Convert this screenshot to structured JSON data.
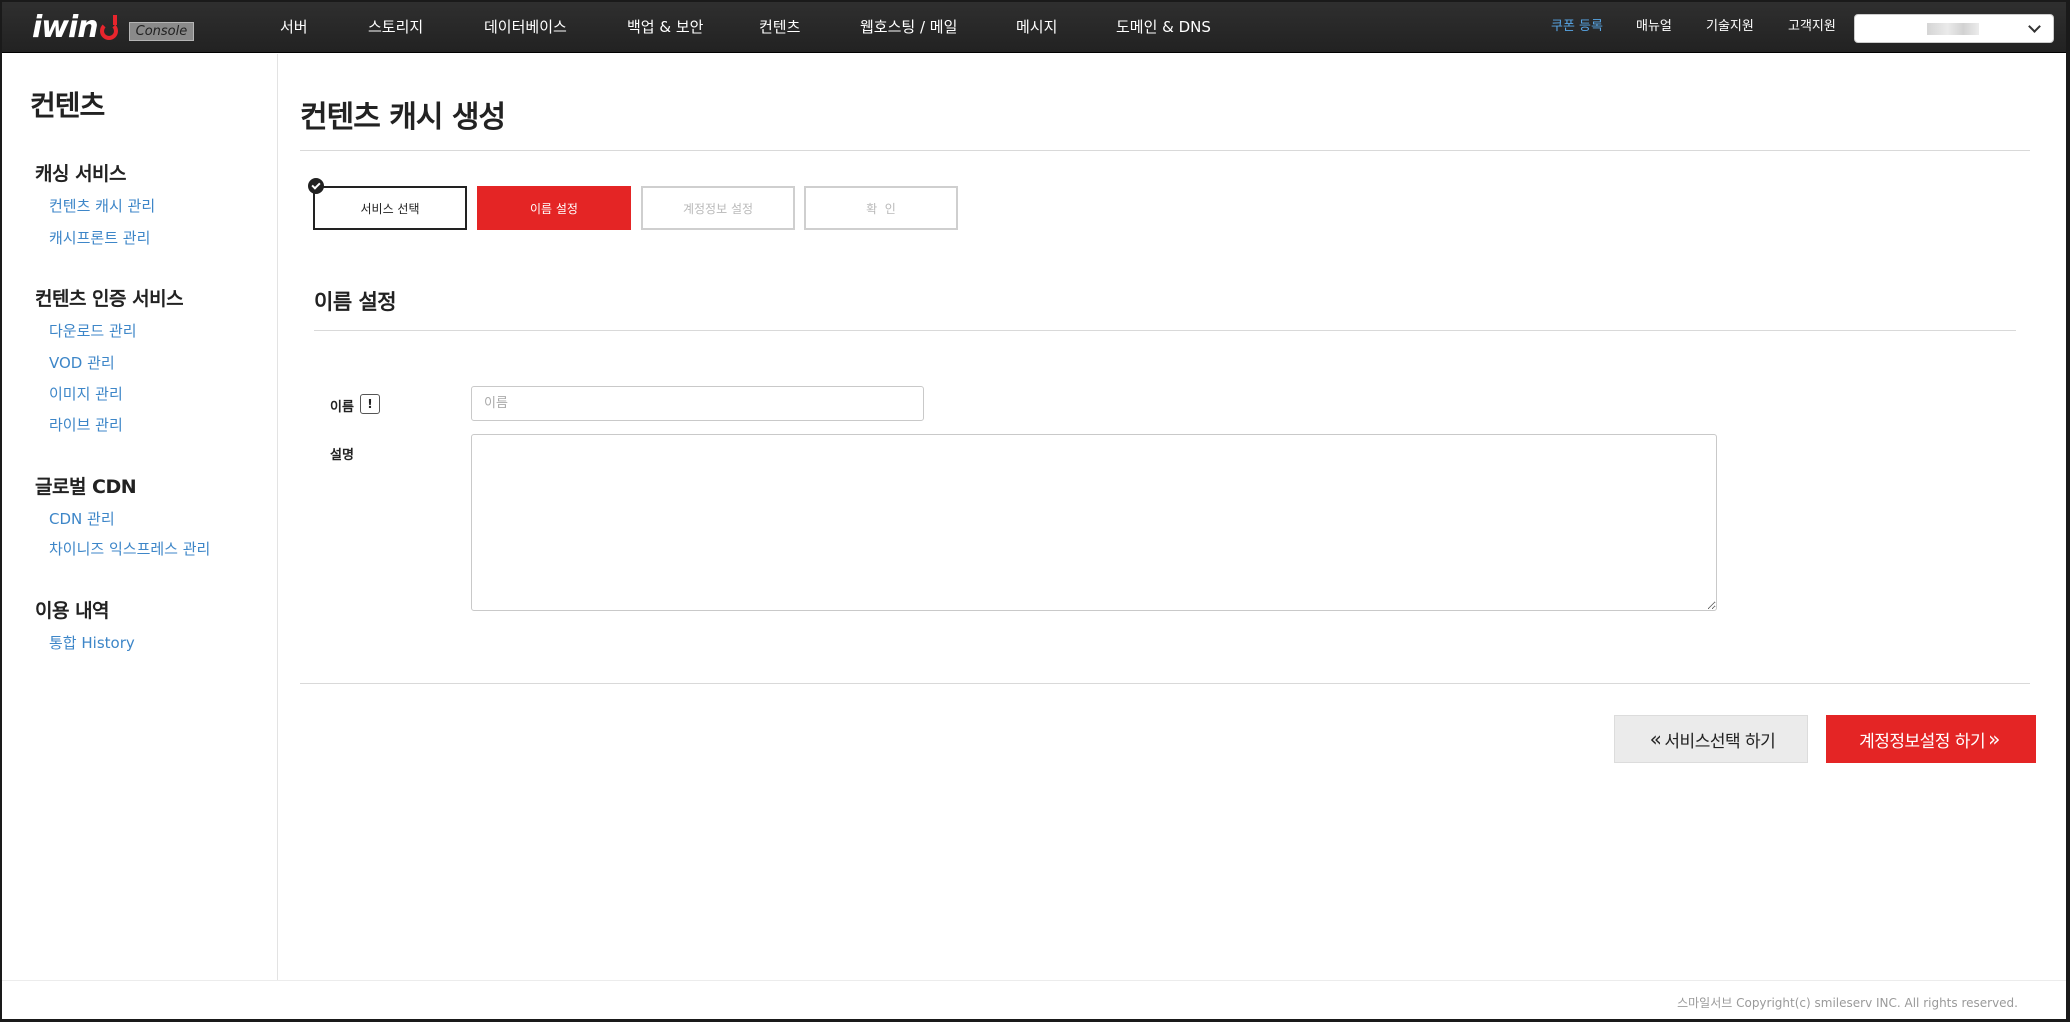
{
  "brand": {
    "logo_text": "iwin",
    "badge": "Console"
  },
  "nav": {
    "items": [
      "서버",
      "스토리지",
      "데이터베이스",
      "백업 & 보안",
      "컨텐츠",
      "웹호스팅 / 메일",
      "메시지",
      "도메인 & DNS"
    ]
  },
  "util_nav": {
    "coupon": "쿠폰 등록",
    "manual": "매뉴얼",
    "tech_support": "기술지원",
    "customer_support": "고객지원"
  },
  "sidebar": {
    "title": "컨텐츠",
    "groups": [
      {
        "title": "캐싱 서비스",
        "links": [
          "컨텐츠 캐시 관리",
          "캐시프론트 관리"
        ]
      },
      {
        "title": "컨텐츠 인증 서비스",
        "links": [
          "다운로드 관리",
          "VOD 관리",
          "이미지 관리",
          "라이브 관리"
        ]
      },
      {
        "title": "글로벌 CDN",
        "links": [
          "CDN 관리",
          "차이니즈 익스프레스 관리"
        ]
      },
      {
        "title": "이용 내역",
        "links": [
          "통합 History"
        ]
      }
    ]
  },
  "main": {
    "page_title": "컨텐츠 캐시 생성",
    "steps": [
      {
        "label": "서비스 선택",
        "state": "completed"
      },
      {
        "label": "이름 설정",
        "state": "active"
      },
      {
        "label": "계정정보 설정",
        "state": "pending"
      },
      {
        "label": "확  인",
        "state": "pending"
      }
    ],
    "section_title": "이름 설정",
    "form": {
      "name_label": "이름",
      "name_info_icon": "!",
      "name_placeholder": "이름",
      "name_value": "",
      "description_label": "설명",
      "description_value": ""
    },
    "buttons": {
      "prev_label": "서비스선택 하기",
      "next_label": "계정정보설정 하기",
      "prev_arrow": "«",
      "next_arrow": "»"
    }
  },
  "footer": {
    "copyright": "스마일서브 Copyright(c) smileserv INC. All rights reserved."
  },
  "colors": {
    "accent": "#e42525",
    "link": "#3d86c8",
    "coupon": "#58a6e6",
    "topbar": "#2a2a2a"
  },
  "icons": {
    "step_done": "check-circle-icon",
    "dropdown": "chevron-down-icon",
    "info": "exclamation-icon",
    "logo": "power-icon"
  }
}
